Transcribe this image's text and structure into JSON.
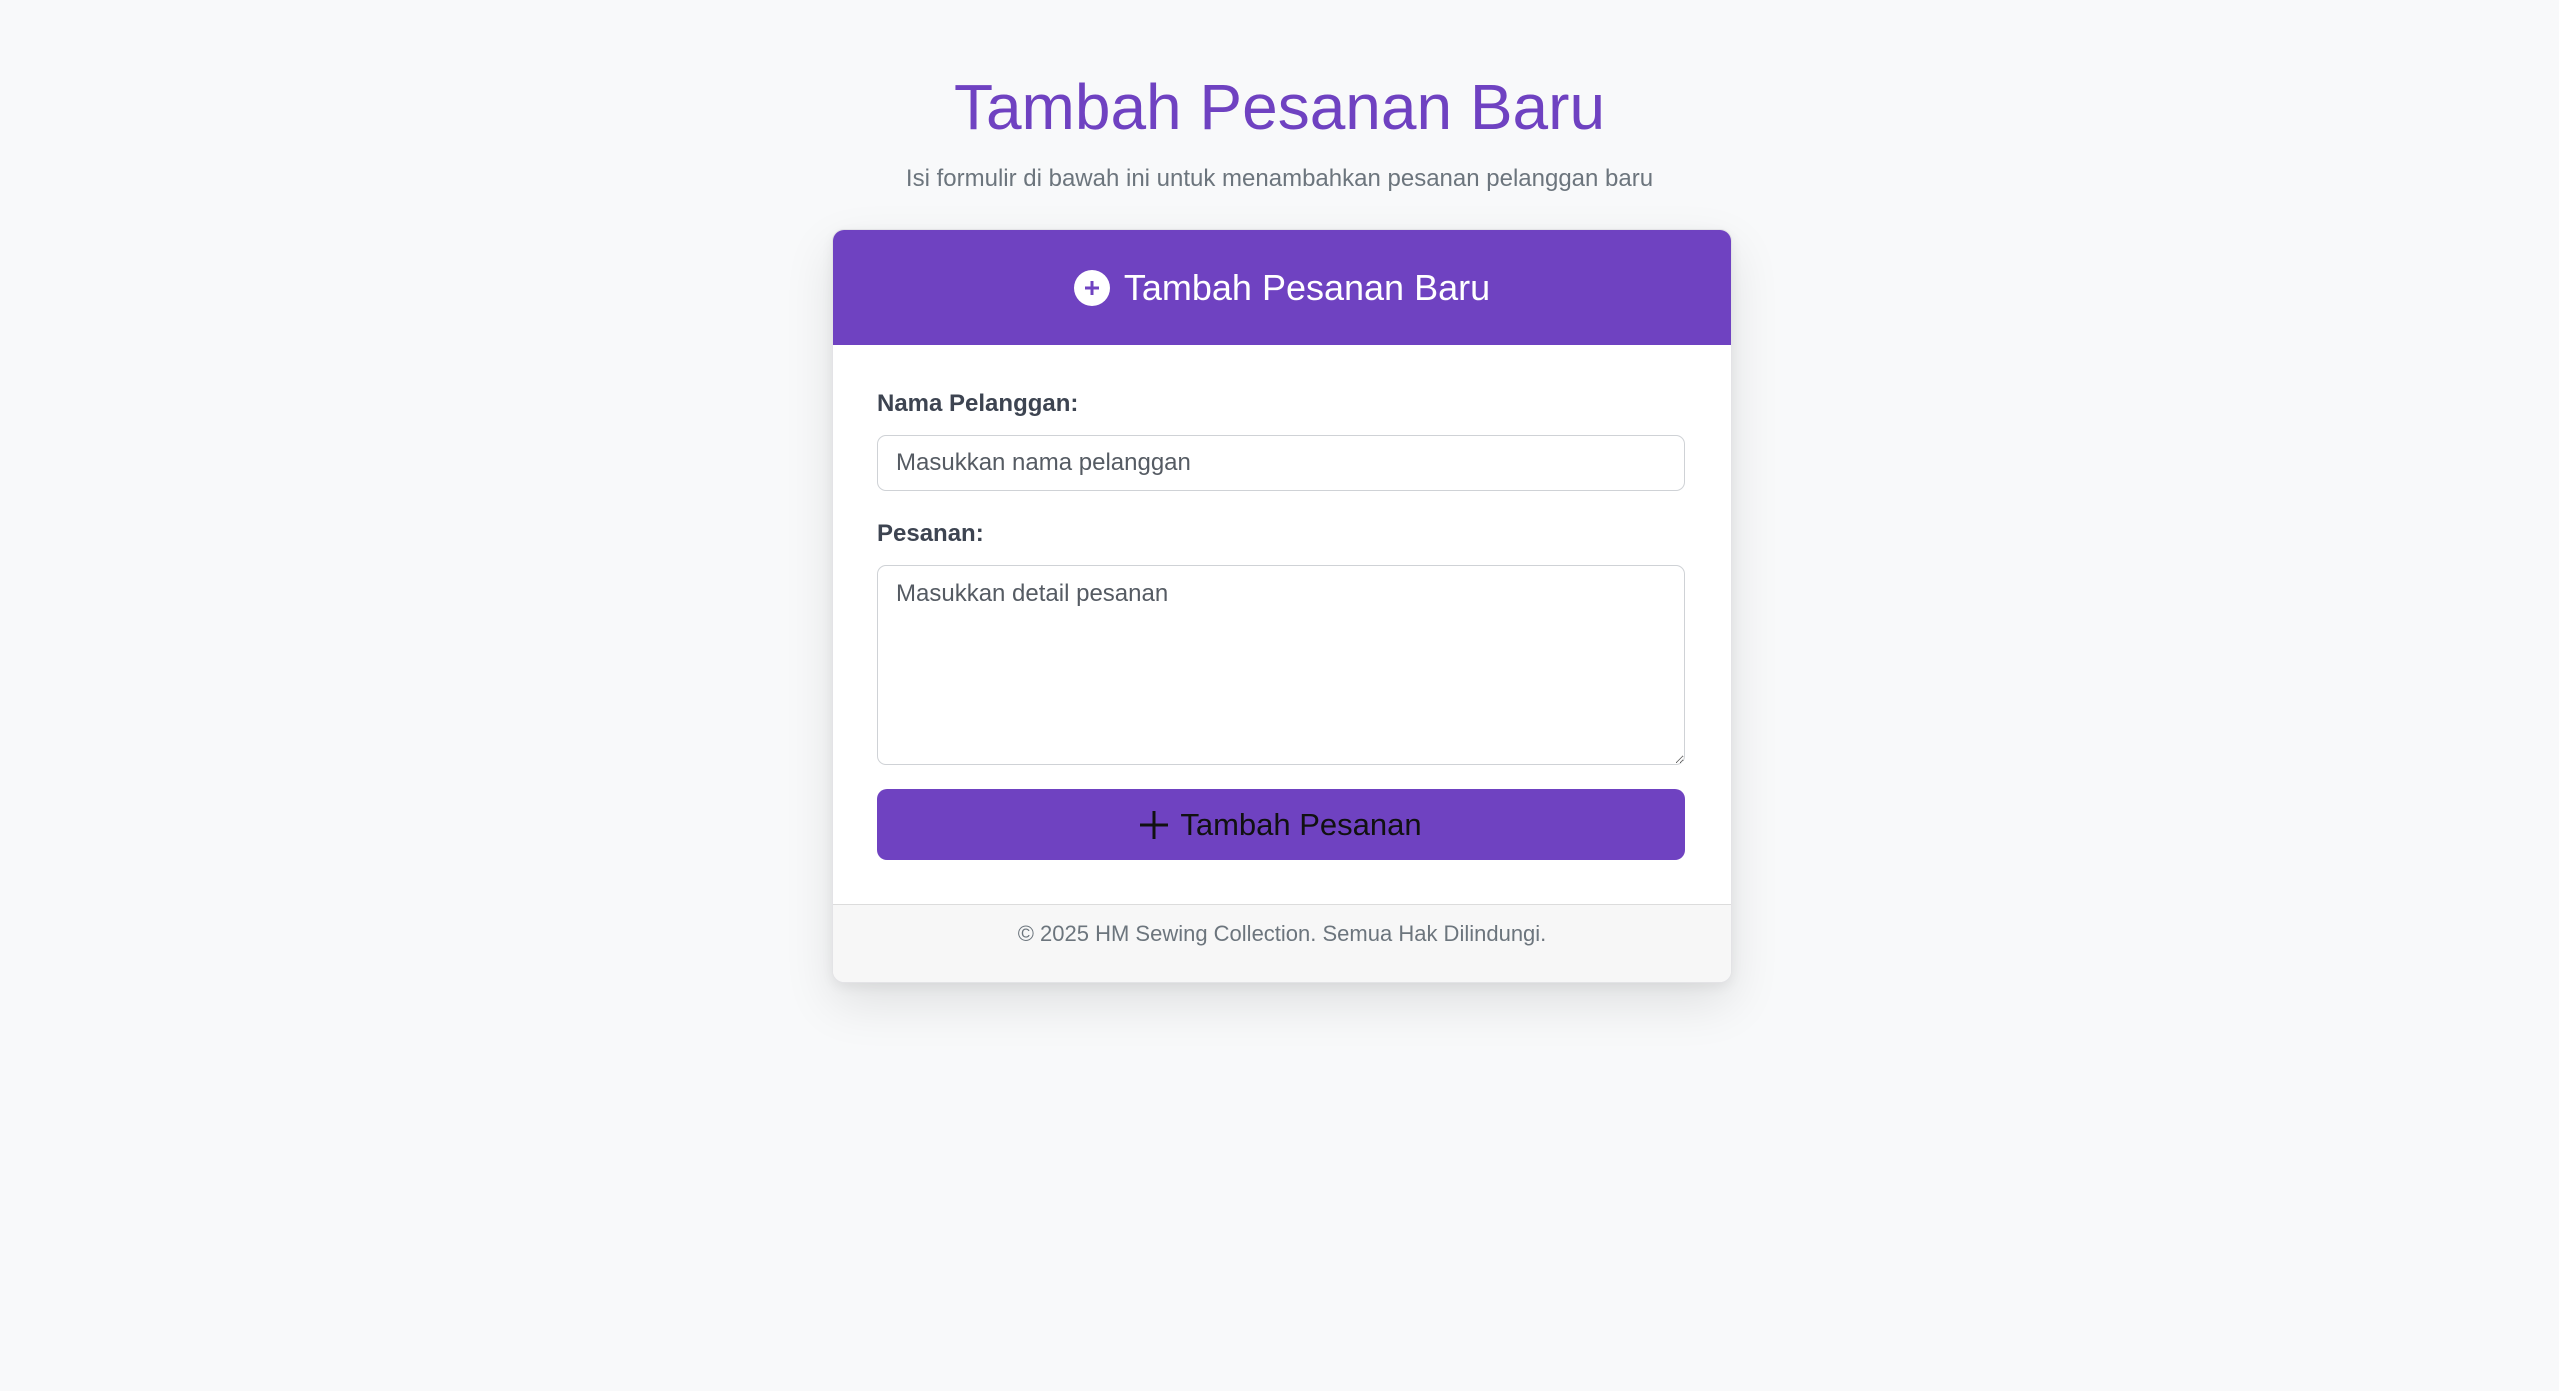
{
  "header": {
    "title": "Tambah Pesanan Baru",
    "subtitle": "Isi formulir di bawah ini untuk menambahkan pesanan pelanggan baru"
  },
  "card": {
    "title": "Tambah Pesanan Baru",
    "icon": "plus-circle-icon"
  },
  "form": {
    "customer_label": "Nama Pelanggan:",
    "customer_placeholder": "Masukkan nama pelanggan",
    "customer_value": "",
    "order_label": "Pesanan:",
    "order_placeholder": "Masukkan detail pesanan",
    "order_value": "",
    "submit_label": "Tambah Pesanan",
    "submit_icon": "plus-icon"
  },
  "footer": {
    "text": "© 2025 HM Sewing Collection. Semua Hak Dilindungi."
  },
  "colors": {
    "accent": "#6f42c1",
    "background": "#f8f9fa",
    "muted_text": "#6c757d"
  }
}
